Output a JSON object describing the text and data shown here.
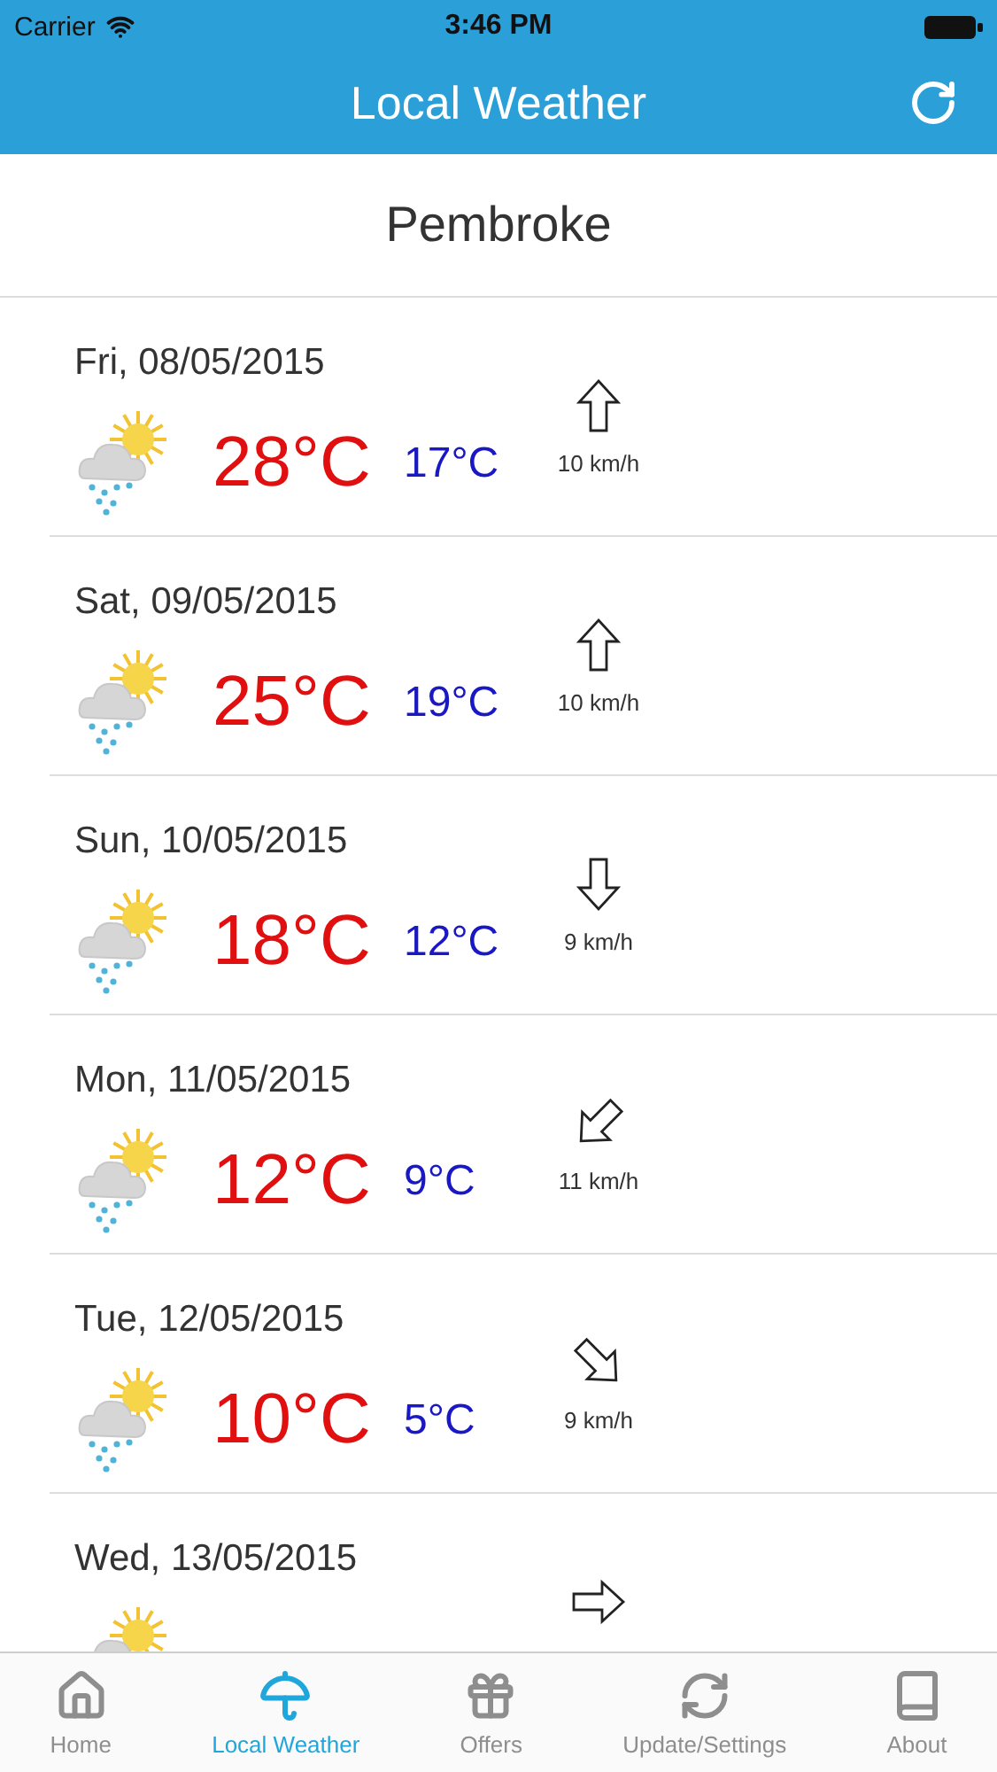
{
  "status_bar": {
    "carrier": "Carrier",
    "time": "3:46 PM"
  },
  "nav_bar": {
    "title": "Local Weather"
  },
  "location": "Pembroke",
  "forecast": [
    {
      "date": "Fri, 08/05/2015",
      "high": "28°C",
      "low": "17°C",
      "wind": {
        "kind": "up",
        "speed": "10 km/h"
      }
    },
    {
      "date": "Sat, 09/05/2015",
      "high": "25°C",
      "low": "19°C",
      "wind": {
        "kind": "up",
        "speed": "10 km/h"
      }
    },
    {
      "date": "Sun, 10/05/2015",
      "high": "18°C",
      "low": "12°C",
      "wind": {
        "kind": "down",
        "speed": "9 km/h"
      }
    },
    {
      "date": "Mon, 11/05/2015",
      "high": "12°C",
      "low": "9°C",
      "wind": {
        "kind": "down-left",
        "speed": "11 km/h"
      }
    },
    {
      "date": "Tue, 12/05/2015",
      "high": "10°C",
      "low": "5°C",
      "wind": {
        "kind": "down-right",
        "speed": "9 km/h"
      }
    },
    {
      "date": "Wed, 13/05/2015",
      "wind": {
        "kind": "right"
      }
    }
  ],
  "tab_bar": [
    {
      "label": "Home",
      "kind": "home",
      "selected": false
    },
    {
      "label": "Local Weather",
      "kind": "umbrella",
      "selected": true
    },
    {
      "label": "Offers",
      "kind": "gift",
      "selected": false
    },
    {
      "label": "Update/Settings",
      "kind": "refresh",
      "selected": false
    },
    {
      "label": "About",
      "kind": "book",
      "selected": false
    }
  ]
}
